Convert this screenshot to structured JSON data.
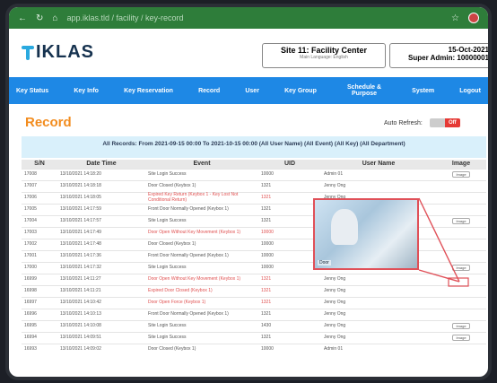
{
  "browser": {
    "url": "app.iklas.tld / facility / key-record"
  },
  "header": {
    "logo_text": "IKLAS",
    "site_title": "Site 11: Facility Center",
    "site_sub": "Main Language: English",
    "date": "15-Oct-2021",
    "admin": "Super Admin: 10000001"
  },
  "nav": [
    "Key Status",
    "Key Info",
    "Key Reservation",
    "Record",
    "User",
    "Key Group",
    "Schedule & Purpose",
    "System",
    "Logout"
  ],
  "page": {
    "title": "Record",
    "auto_refresh_label": "Auto Refresh:",
    "auto_refresh_state": "Off",
    "banner": "All Records: From 2021-09-15 00:00 To 2021-10-15 00:00 (All User Name) (All Event) (All Key) (All Department)"
  },
  "table": {
    "headers": [
      "S/N",
      "Date Time",
      "Event",
      "UID",
      "User Name",
      "Image"
    ],
    "rows": [
      {
        "sn": "17008",
        "dt": "13/10/2021 14:18:20",
        "ev": "Site Login Success",
        "uid": "10000",
        "user": "Admin 01",
        "img": "Image",
        "red": false
      },
      {
        "sn": "17007",
        "dt": "13/10/2021 14:18:18",
        "ev": "Door Closed (Keybox 1)",
        "uid": "1321",
        "user": "Jenny Ong",
        "img": "",
        "red": false
      },
      {
        "sn": "17006",
        "dt": "13/10/2021 14:18:05",
        "ev": "Expired Key Return (Keybox 1 - Key Lost Not Conditional Return)",
        "uid": "1321",
        "user": "Jenny Ong",
        "img": "",
        "red": true
      },
      {
        "sn": "17005",
        "dt": "13/10/2021 14:17:59",
        "ev": "Front Door Normally Opened (Keybox 1)",
        "uid": "1321",
        "user": "Jenny Ong",
        "img": "",
        "red": false
      },
      {
        "sn": "17004",
        "dt": "13/10/2021 14:17:57",
        "ev": "Site Login Success",
        "uid": "1321",
        "user": "Jenny Ong",
        "img": "Image",
        "red": false
      },
      {
        "sn": "17003",
        "dt": "13/10/2021 14:17:49",
        "ev": "Door Open Without Key Movement (Keybox 1)",
        "uid": "10000",
        "user": "",
        "img": "",
        "red": true
      },
      {
        "sn": "17002",
        "dt": "13/10/2021 14:17:48",
        "ev": "Door Closed (Keybox 1)",
        "uid": "10000",
        "user": "",
        "img": "",
        "red": false
      },
      {
        "sn": "17001",
        "dt": "13/10/2021 14:17:36",
        "ev": "Front Door Normally Opened (Keybox 1)",
        "uid": "10000",
        "user": "",
        "img": "",
        "red": false
      },
      {
        "sn": "17000",
        "dt": "13/10/2021 14:17:32",
        "ev": "Site Login Success",
        "uid": "10000",
        "user": "Admin 01",
        "img": "Image",
        "red": false
      },
      {
        "sn": "16999",
        "dt": "13/10/2021 14:11:27",
        "ev": "Door Open Without Key Movement (Keybox 1)",
        "uid": "1321",
        "user": "Jenny Ong",
        "img": "",
        "red": true
      },
      {
        "sn": "16998",
        "dt": "13/10/2021 14:11:21",
        "ev": "Expired Door Closed (Keybox 1)",
        "uid": "1321",
        "user": "Jenny Ong",
        "img": "",
        "red": true
      },
      {
        "sn": "16997",
        "dt": "13/10/2021 14:10:42",
        "ev": "Door Open Force (Keybox 1)",
        "uid": "1321",
        "user": "Jenny Ong",
        "img": "",
        "red": true
      },
      {
        "sn": "16996",
        "dt": "13/10/2021 14:10:13",
        "ev": "Front Door Normally Opened (Keybox 1)",
        "uid": "1321",
        "user": "Jenny Ong",
        "img": "",
        "red": false
      },
      {
        "sn": "16995",
        "dt": "13/10/2021 14:10:08",
        "ev": "Site Login Success",
        "uid": "1430",
        "user": "Jenny Ong",
        "img": "Image",
        "red": false
      },
      {
        "sn": "16994",
        "dt": "13/10/2021 14:09:51",
        "ev": "Site Login Success",
        "uid": "1321",
        "user": "Jenny Ong",
        "img": "Image",
        "red": false
      },
      {
        "sn": "16993",
        "dt": "13/10/2021 14:09:02",
        "ev": "Door Closed (Keybox 1)",
        "uid": "10000",
        "user": "Admin 01",
        "img": "",
        "red": false
      }
    ]
  },
  "popup": {
    "caption": "Door"
  },
  "colors": {
    "accent": "#1e88e5",
    "title": "#f28c1e",
    "alert": "#e05050"
  }
}
